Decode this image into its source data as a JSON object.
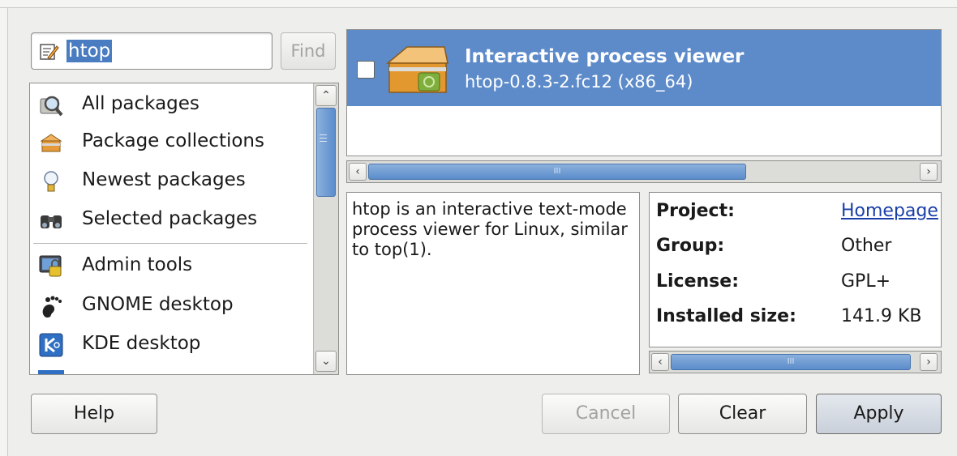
{
  "search": {
    "value": "htop",
    "find_label": "Find"
  },
  "categories": [
    {
      "label": "All packages",
      "icon": "magnifier-icon"
    },
    {
      "label": "Package collections",
      "icon": "box-icon"
    },
    {
      "label": "Newest packages",
      "icon": "lightbulb-icon"
    },
    {
      "label": "Selected packages",
      "icon": "binoculars-icon"
    },
    {
      "label": "Admin tools",
      "icon": "admin-lock-icon"
    },
    {
      "label": "GNOME desktop",
      "icon": "gnome-foot-icon"
    },
    {
      "label": "KDE desktop",
      "icon": "kde-icon"
    }
  ],
  "packages": [
    {
      "title": "Interactive process viewer",
      "version": "htop-0.8.3-2.fc12 (x86_64)",
      "checked": false
    }
  ],
  "description": "htop is an interactive text-mode process viewer for Linux, similar to top(1).",
  "details": [
    {
      "key": "Project:",
      "value": "Homepage"
    },
    {
      "key": "Group:",
      "value": "Other"
    },
    {
      "key": "License:",
      "value": "GPL+"
    },
    {
      "key": "Installed size:",
      "value": "141.9 KB"
    }
  ],
  "buttons": {
    "help": "Help",
    "cancel": "Cancel",
    "clear": "Clear",
    "apply": "Apply"
  },
  "colors": {
    "selection": "#5d8bca",
    "search_highlight": "#4a7cc1",
    "link": "#1a3fa8"
  }
}
